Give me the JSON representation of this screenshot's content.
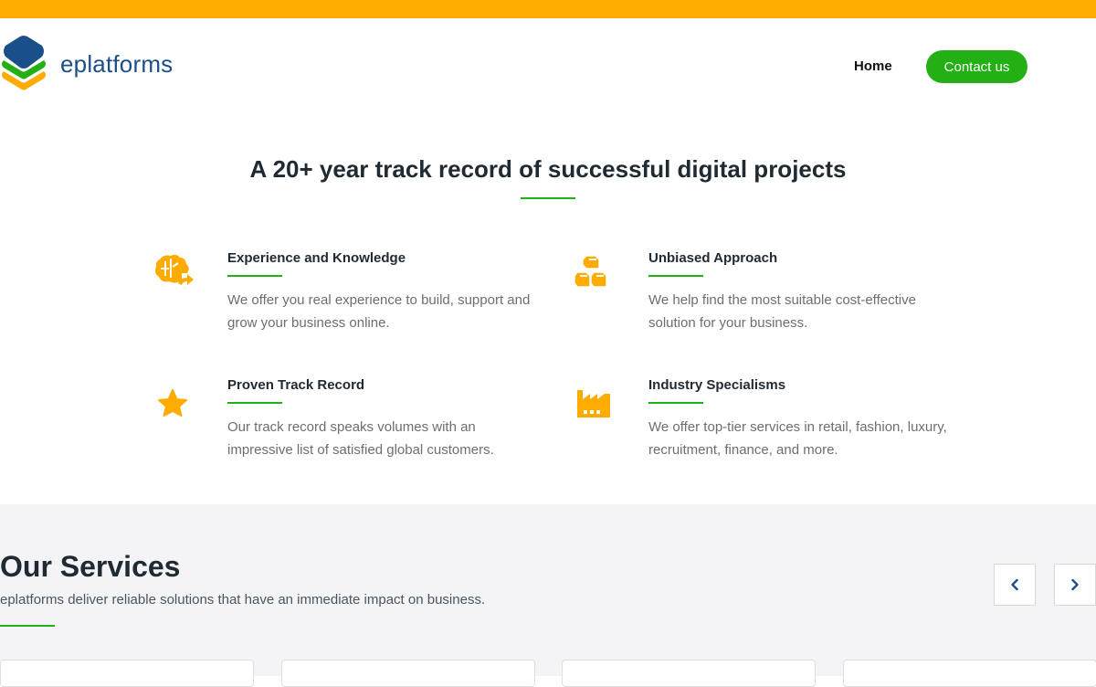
{
  "brand": {
    "name": "eplatforms",
    "colors": {
      "top_bar": "#ffab00",
      "blue": "#1b4f8a",
      "green": "#22b014",
      "orange": "#ffab00"
    }
  },
  "nav": {
    "home_label": "Home",
    "contact_label": "Contact us"
  },
  "intro": {
    "headline": "A 20+ year track record of successful digital projects"
  },
  "features": [
    {
      "icon": "brain-icon",
      "title": "Experience and Knowledge",
      "desc": "We offer you real experience to build, support and grow your business online."
    },
    {
      "icon": "boxes-icon",
      "title": "Unbiased Approach",
      "desc": "We help find the most suitable cost-effective solution for your business."
    },
    {
      "icon": "star-icon",
      "title": "Proven Track Record",
      "desc": "Our track record speaks volumes with an impressive list of satisfied global customers."
    },
    {
      "icon": "factory-icon",
      "title": "Industry Specialisms",
      "desc": "We offer top-tier services in retail, fashion, luxury, recruitment, finance, and more."
    }
  ],
  "services": {
    "title": "Our Services",
    "subtitle": "eplatforms deliver reliable solutions that have an immediate impact on business.",
    "prev_icon": "chevron-left-icon",
    "next_icon": "chevron-right-icon"
  }
}
